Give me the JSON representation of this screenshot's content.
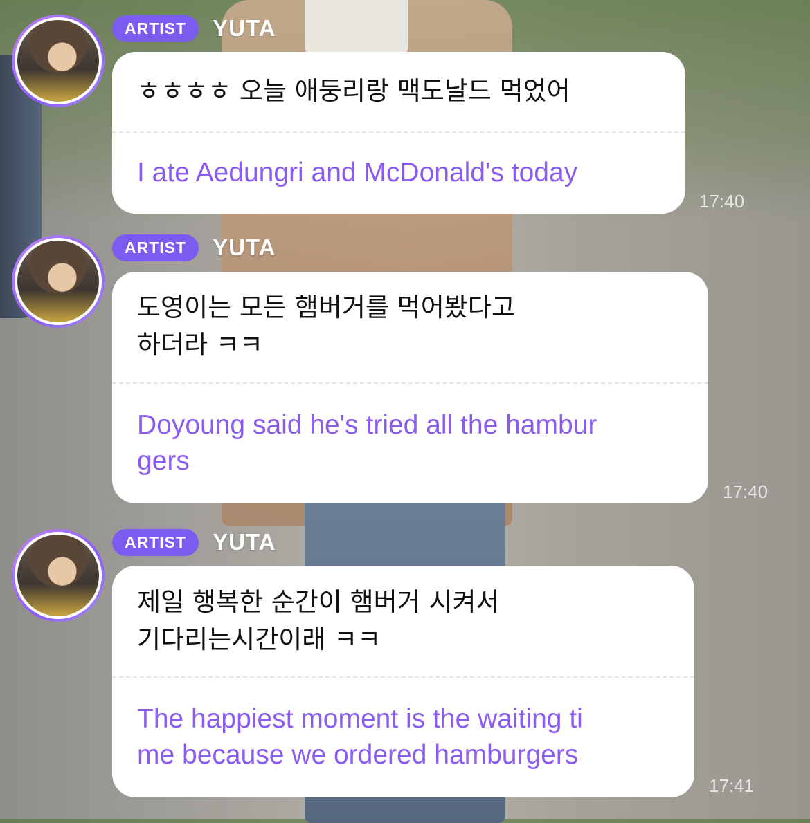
{
  "messages": [
    {
      "badge": "ARTIST",
      "sender": "YUTA",
      "original": "ㅎㅎㅎㅎ 오늘 애둥리랑 맥도날드 먹었어",
      "translation": "I ate Aedungri and McDonald's today",
      "time": "17:40"
    },
    {
      "badge": "ARTIST",
      "sender": "YUTA",
      "original": "도영이는 모든 햄버거를 먹어봤다고\n하더라 ㅋㅋ",
      "translation": "Doyoung said he's tried all the hambur\ngers",
      "time": "17:40"
    },
    {
      "badge": "ARTIST",
      "sender": "YUTA",
      "original": "제일 행복한 순간이 햄버거 시켜서\n기다리는시간이래 ㅋㅋ",
      "translation": "The happiest moment is the waiting ti\nme because we ordered hamburgers",
      "time": "17:41"
    }
  ],
  "colors": {
    "accent": "#7b5cf0",
    "translation_text": "#8a5cf0",
    "bubble": "#ffffff"
  },
  "icons": {
    "avatar": "profile-photo"
  }
}
